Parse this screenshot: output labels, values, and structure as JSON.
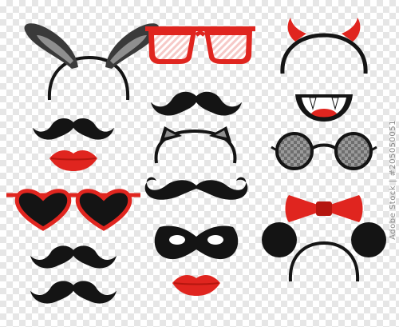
{
  "watermark": "Adobe Stock | #205050051",
  "colors": {
    "black": "#141414",
    "dark_gray": "#3a3a3a",
    "gray": "#8f8f8f",
    "red": "#e0251f",
    "dark_red": "#b5160f",
    "lens_gray": "#8a8a8a",
    "checker": "#e6e6e6"
  },
  "items": [
    {
      "name": "bunny-ears-headband-icon"
    },
    {
      "name": "red-striped-sunglasses-icon"
    },
    {
      "name": "devil-horns-headband-icon"
    },
    {
      "name": "mustache-icon"
    },
    {
      "name": "vampire-fangs-mouth-icon"
    },
    {
      "name": "red-lips-icon"
    },
    {
      "name": "cat-ears-headband-icon"
    },
    {
      "name": "round-sunglasses-icon"
    },
    {
      "name": "heart-sunglasses-icon"
    },
    {
      "name": "curly-mustache-icon"
    },
    {
      "name": "red-bow-tie-icon"
    },
    {
      "name": "masquerade-mask-icon"
    },
    {
      "name": "mouse-ears-headband-icon"
    }
  ]
}
